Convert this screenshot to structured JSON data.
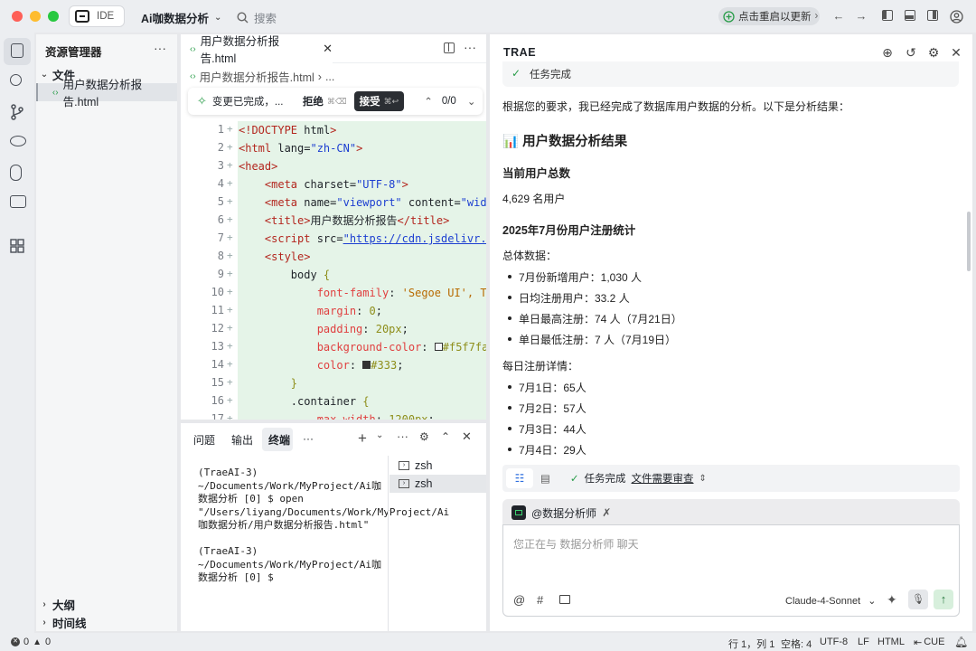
{
  "titlebar": {
    "mode_label": "IDE",
    "project_name": "Ai咖数据分析",
    "search_placeholder": "搜索",
    "restart_label": "点击重启以更新"
  },
  "explorer": {
    "header": "资源管理器",
    "folder": "文件",
    "file": "用户数据分析报告.html",
    "outline": "大纲",
    "timeline": "时间线"
  },
  "editor": {
    "tab_label": "用户数据分析报告.html",
    "breadcrumb_file": "用户数据分析报告.html",
    "breadcrumb_more": "...",
    "change_text": "变更已完成，...",
    "reject_label": "拒绝",
    "reject_shortcut": "⌘⌫",
    "accept_label": "接受",
    "accept_shortcut": "⌘↩",
    "change_counter": "0/0",
    "line_numbers": [
      "1",
      "2",
      "3",
      "4",
      "5",
      "6",
      "7",
      "8",
      "9",
      "10",
      "11",
      "12",
      "13",
      "14",
      "15",
      "16",
      "17"
    ]
  },
  "bottom_panel": {
    "tabs": [
      "问题",
      "输出",
      "终端",
      "···"
    ],
    "terminal_text": "(TraeAI-3) ~/Documents/Work/MyProject/Ai咖数据分析 [0] $ open \"/Users/liyang/Documents/Work/MyProject/Ai咖数据分析/用户数据分析报告.html\"\n\n(TraeAI-3) ~/Documents/Work/MyProject/Ai咖数据分析 [0] $ ",
    "terminals": [
      "zsh",
      "zsh"
    ]
  },
  "chat": {
    "title": "TRAE",
    "task_done_top": "任务完成",
    "intro": "根据您的要求，我已经完成了数据库用户数据的分析。以下是分析结果：",
    "heading": "📊 用户数据分析结果",
    "total_heading": "当前用户总数",
    "total_value": "4,629 名用户",
    "july_heading": "2025年7月份用户注册统计",
    "overall_label": "总体数据：",
    "overall_items": [
      "7月份新增用户：1,030 人",
      "日均注册用户：33.2 人",
      "单日最高注册：74 人（7月21日）",
      "单日最低注册：7 人（7月19日）"
    ],
    "daily_label": "每日注册详情：",
    "daily_items": [
      "7月1日：65人",
      "7月2日：57人",
      "7月3日：44人",
      "7月4日：29人"
    ],
    "task_status": "任务完成",
    "task_link": "文件需要审查",
    "agent_name": "@数据分析师",
    "input_placeholder": "您正在与 数据分析师 聊天",
    "model": "Claude-4-Sonnet"
  },
  "statusbar": {
    "errors": "0",
    "warnings": "0",
    "position": "行 1，列 1",
    "spaces": "空格: 4",
    "encoding": "UTF-8",
    "eol": "LF",
    "language": "HTML",
    "cue": "CUE"
  }
}
